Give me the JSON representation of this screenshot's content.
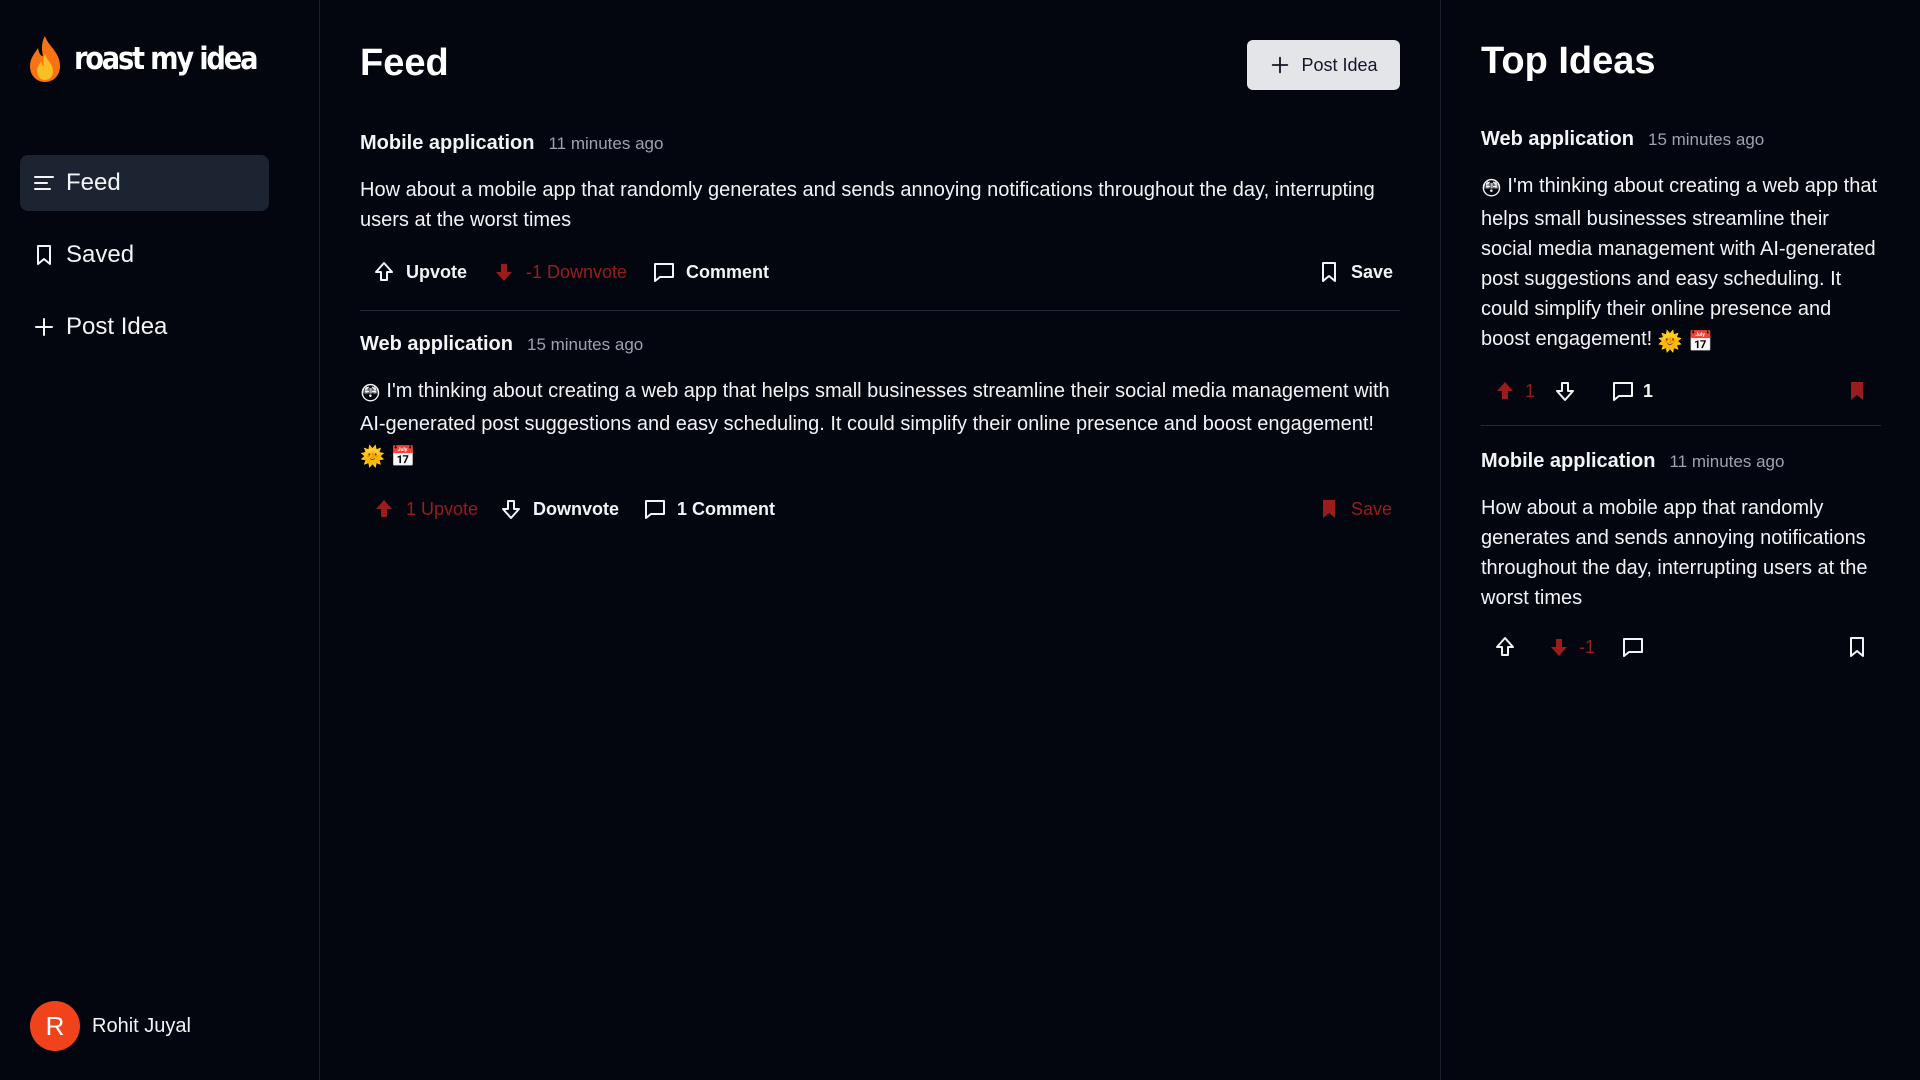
{
  "sidebar": {
    "logo_text": "roast my idea",
    "nav": [
      {
        "label": "Feed",
        "icon": "menu-icon",
        "active": true
      },
      {
        "label": "Saved",
        "icon": "bookmark-icon",
        "active": false
      },
      {
        "label": "Post Idea",
        "icon": "plus-icon",
        "active": false
      }
    ],
    "user": {
      "initial": "R",
      "name": "Rohit Juyal"
    }
  },
  "feed": {
    "title": "Feed",
    "post_button": "Post Idea",
    "posts": [
      {
        "category": "Mobile application",
        "time": "11 minutes ago",
        "body": "How about a mobile app that randomly generates and sends annoying notifications throughout the day, interrupting users at the worst times",
        "upvote": "Upvote",
        "downvote": "-1 Downvote",
        "comment": "Comment",
        "save": "Save",
        "upvoted": false,
        "downvoted": true,
        "saved": false
      },
      {
        "category": "Web application",
        "time": "15 minutes ago",
        "emoji_lead": "😳",
        "body": "I'm thinking about creating a web app that helps small businesses streamline their social media management with AI-generated post suggestions and easy scheduling. It could simplify their online presence and boost engagement!",
        "emoji_trail": "🌞 📅",
        "upvote": "1 Upvote",
        "downvote": "Downvote",
        "comment": "1 Comment",
        "save": "Save",
        "upvoted": true,
        "downvoted": false,
        "saved": true
      }
    ]
  },
  "top_ideas": {
    "title": "Top Ideas",
    "items": [
      {
        "category": "Web application",
        "time": "15 minutes ago",
        "emoji_lead": "😳",
        "body": "I'm thinking about creating a web app that helps small businesses streamline their social media management with AI-generated post suggestions and easy scheduling. It could simplify their online presence and boost engagement!",
        "emoji_trail": "🌞 📅",
        "upvote_count": "1",
        "comment_count": "1",
        "upvoted": true,
        "saved": true
      },
      {
        "category": "Mobile application",
        "time": "11 minutes ago",
        "body": "How about a mobile app that randomly generates and sends annoying notifications throughout the day, interrupting users at the worst times",
        "downvote_count": "-1",
        "downvoted": true,
        "saved": false
      }
    ]
  },
  "colors": {
    "background": "#03060f",
    "accent_red": "#9b1c1c",
    "avatar": "#f0421b",
    "active_nav": "#1c2431",
    "button": "#e3e5e8"
  }
}
